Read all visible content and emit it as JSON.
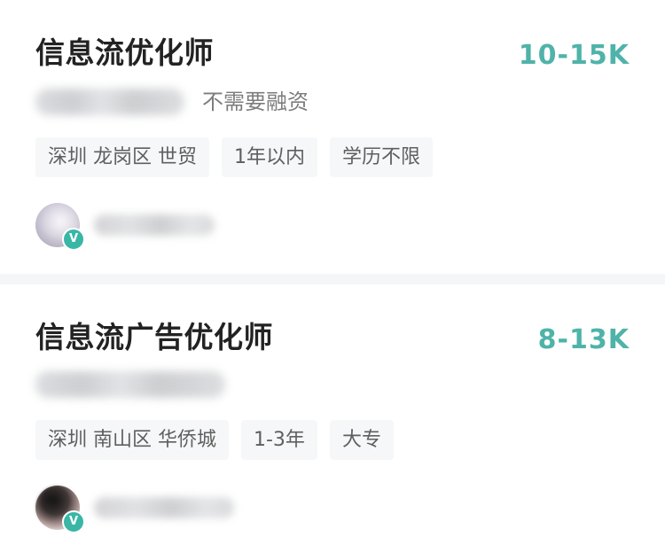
{
  "jobs": [
    {
      "title": "信息流优化师",
      "salary": "10-15K",
      "funding": "不需要融资",
      "tags": [
        "深圳 龙岗区 世贸",
        "1年以内",
        "学历不限"
      ],
      "verified_badge": "V"
    },
    {
      "title": "信息流广告优化师",
      "salary": "8-13K",
      "funding": "",
      "tags": [
        "深圳 南山区 华侨城",
        "1-3年",
        "大专"
      ],
      "verified_badge": "V"
    }
  ],
  "colors": {
    "accent": "#4fb3a9",
    "badge": "#39b6a6",
    "title": "#222222",
    "secondary_text": "#7c7c7c",
    "tag_bg": "#f6f7f8",
    "page_bg": "#f5f6f7"
  },
  "icons": {
    "verified": "verified-badge-icon",
    "avatar": "avatar"
  }
}
